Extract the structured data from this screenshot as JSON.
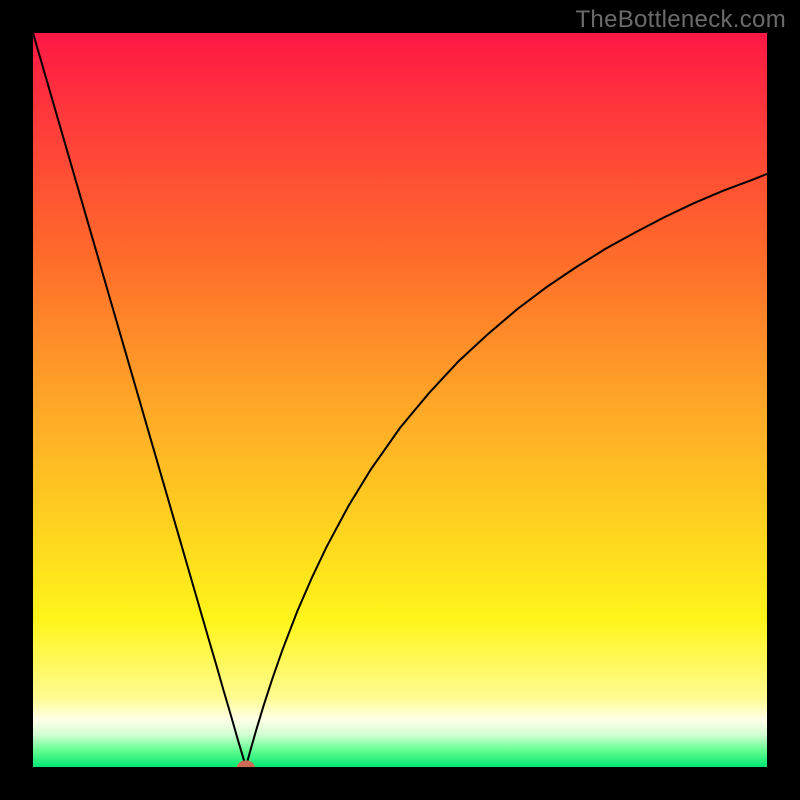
{
  "watermark": "TheBottleneck.com",
  "chart_data": {
    "type": "line",
    "title": "",
    "xlabel": "",
    "ylabel": "",
    "xlim": [
      0,
      100
    ],
    "ylim": [
      0,
      100
    ],
    "gradient_stops": [
      {
        "offset": 0.0,
        "color": "#ff1744"
      },
      {
        "offset": 0.12,
        "color": "#ff3b3b"
      },
      {
        "offset": 0.3,
        "color": "#ff6a2a"
      },
      {
        "offset": 0.5,
        "color": "#ffa528"
      },
      {
        "offset": 0.67,
        "color": "#ffd21f"
      },
      {
        "offset": 0.8,
        "color": "#fff51a"
      },
      {
        "offset": 0.905,
        "color": "#fffb90"
      },
      {
        "offset": 0.935,
        "color": "#ffffe6"
      },
      {
        "offset": 0.955,
        "color": "#d6ffd5"
      },
      {
        "offset": 0.975,
        "color": "#6fff97"
      },
      {
        "offset": 1.0,
        "color": "#00e870"
      }
    ],
    "marker": {
      "x": 29.0,
      "y": 0.0,
      "color": "#cc6a55",
      "rx": 1.2,
      "ry": 0.9
    },
    "series": [
      {
        "name": "curve",
        "x": [
          0.0,
          2,
          4,
          6,
          8,
          10,
          12,
          14,
          16,
          18,
          20,
          22,
          24,
          25,
          26,
          27,
          28,
          28.6,
          29.0,
          29.6,
          30.4,
          31.4,
          32.6,
          34,
          36,
          38,
          40,
          43,
          46,
          50,
          54,
          58,
          62,
          66,
          70,
          74,
          78,
          82,
          86,
          90,
          94,
          98,
          100
        ],
        "y": [
          100,
          93.1,
          86.2,
          79.3,
          72.4,
          65.5,
          58.6,
          51.7,
          44.8,
          37.9,
          31.0,
          24.1,
          17.2,
          13.8,
          10.3,
          6.9,
          3.4,
          1.4,
          0.0,
          2.2,
          5.0,
          8.3,
          12.0,
          16.0,
          21.2,
          25.8,
          30.0,
          35.6,
          40.5,
          46.2,
          51.0,
          55.3,
          59.0,
          62.4,
          65.4,
          68.1,
          70.6,
          72.8,
          74.9,
          76.8,
          78.5,
          80.0,
          80.8
        ]
      }
    ]
  }
}
